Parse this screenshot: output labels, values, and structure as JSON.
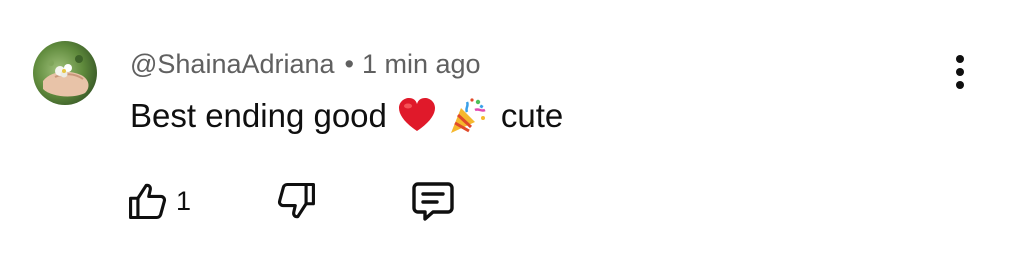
{
  "comment": {
    "author": "@ShainaAdriana",
    "separator": "•",
    "time": "1 min ago",
    "text_before": "Best ending good",
    "emojis": [
      "red-heart",
      "party-popper"
    ],
    "text_after": "cute",
    "like_count": "1"
  },
  "icons": {
    "more": "more-vert-icon",
    "like": "thumb-up-icon",
    "dislike": "thumb-down-icon",
    "reply": "comment-reply-icon"
  },
  "colors": {
    "text": "#0f0f0f",
    "meta": "#606060",
    "heart": "#e0192a"
  }
}
